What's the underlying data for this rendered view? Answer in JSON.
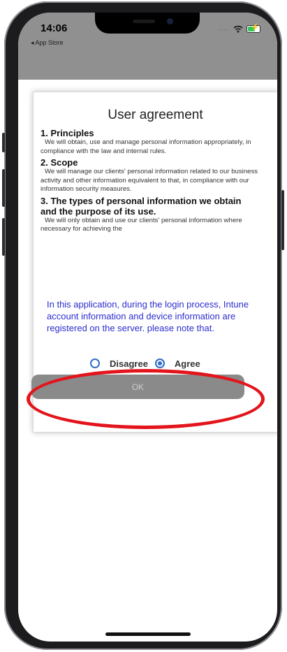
{
  "status_bar": {
    "time": "14:06",
    "back_label": "◂ App Store",
    "signal_icon": "cellular-dots-icon",
    "wifi_icon": "wifi-icon",
    "battery_icon": "battery-charging-icon"
  },
  "dialog": {
    "title": "User agreement",
    "sections": [
      {
        "heading": "1. Principles",
        "body": "We will obtain, use and manage personal information appropriately, in compliance with the law and internal rules."
      },
      {
        "heading": "2. Scope",
        "body": "We will manage our clients' personal information related to our business activity and other information equivalent to that, in compliance with our information security measures."
      },
      {
        "heading": "3. The types of personal information we obtain and the purpose of its use.",
        "body": "We will only obtain and use our clients' personal information where necessary for achieving the"
      }
    ],
    "notice": "In this application, during the login process, Intune account information and device information are registered on the server. please note that.",
    "choices": {
      "disagree_label": "Disagree",
      "agree_label": "Agree",
      "selected": "agree"
    },
    "ok_label": "OK"
  },
  "colors": {
    "notice_text": "#2c2ccf",
    "radio_accent": "#2f6dc9",
    "ok_button_bg": "#8a8a8a",
    "annotation_ring": "#e3141b",
    "dim_overlay": "#909090"
  }
}
